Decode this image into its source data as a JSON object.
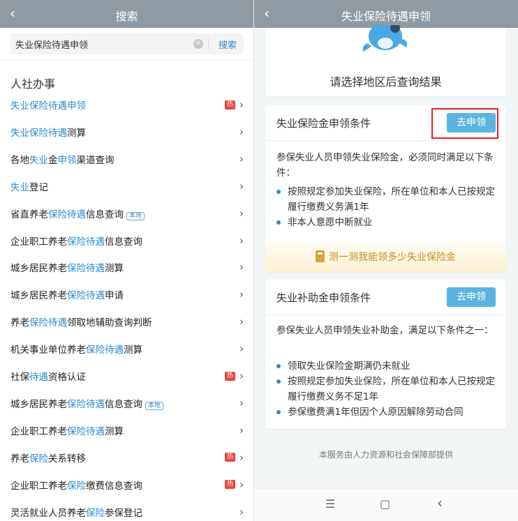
{
  "left": {
    "back_icon": "chevron-left-icon",
    "title": "搜索",
    "search_value": "失业保险待遇申领",
    "search_button": "搜索",
    "section_title": "人社办事",
    "items": [
      {
        "parts": [
          [
            "失业保险待遇申领",
            1
          ]
        ],
        "badge": "热"
      },
      {
        "parts": [
          [
            "失业保险待遇",
            1
          ],
          [
            "测算",
            0
          ]
        ]
      },
      {
        "parts": [
          [
            "各地",
            0
          ],
          [
            "失业",
            1
          ],
          [
            "金",
            0
          ],
          [
            "申领",
            1
          ],
          [
            "渠道查询",
            0
          ]
        ]
      },
      {
        "parts": [
          [
            "失业",
            1
          ],
          [
            "登记",
            0
          ]
        ]
      },
      {
        "parts": [
          [
            "省直养老",
            0
          ],
          [
            "保险待遇",
            1
          ],
          [
            "信息查询",
            0
          ]
        ],
        "tag": "本地"
      },
      {
        "parts": [
          [
            "企业职工养老",
            0
          ],
          [
            "保险待遇",
            1
          ],
          [
            "信息查询",
            0
          ]
        ]
      },
      {
        "parts": [
          [
            "城乡居民养老",
            0
          ],
          [
            "保险待遇",
            1
          ],
          [
            "测算",
            0
          ]
        ]
      },
      {
        "parts": [
          [
            "城乡居民养老",
            0
          ],
          [
            "保险待遇",
            1
          ],
          [
            "申请",
            0
          ]
        ]
      },
      {
        "parts": [
          [
            "养老",
            0
          ],
          [
            "保险待遇",
            1
          ],
          [
            "领取地辅助查询判断",
            0
          ]
        ]
      },
      {
        "parts": [
          [
            "机关事业单位养老",
            0
          ],
          [
            "保险待遇",
            1
          ],
          [
            "测算",
            0
          ]
        ]
      },
      {
        "parts": [
          [
            "社保",
            0
          ],
          [
            "待遇",
            1
          ],
          [
            "资格认证",
            0
          ]
        ],
        "badge": "热"
      },
      {
        "parts": [
          [
            "城乡居民养老",
            0
          ],
          [
            "保险待遇",
            1
          ],
          [
            "信息查询",
            0
          ]
        ],
        "tag": "本地"
      },
      {
        "parts": [
          [
            "企业职工养老",
            0
          ],
          [
            "保险待遇",
            1
          ],
          [
            "测算",
            0
          ]
        ]
      },
      {
        "parts": [
          [
            "养老",
            0
          ],
          [
            "保险",
            1
          ],
          [
            "关系转移",
            0
          ]
        ],
        "badge": "热"
      },
      {
        "parts": [
          [
            "企业职工养老",
            0
          ],
          [
            "保险",
            1
          ],
          [
            "缴费信息查询",
            0
          ]
        ],
        "badge": "热"
      },
      {
        "parts": [
          [
            "灵活就业人员养老",
            0
          ],
          [
            "保险",
            1
          ],
          [
            "参保登记",
            0
          ]
        ]
      }
    ]
  },
  "right": {
    "title": "失业保险待遇申领",
    "region_prompt": "请选择地区后查询结果",
    "card1": {
      "heading": "失业保险金申领条件",
      "apply_label": "去申领",
      "desc": "参保失业人员申领失业保险金，必须同时满足以下条件：",
      "bullets": [
        "按照规定参加失业保险，所在单位和本人已按规定履行缴费义务满1年",
        "非本人意愿中断就业"
      ],
      "calc_label": "测一测我能领多少失业保险金"
    },
    "card2": {
      "heading": "失业补助金申领条件",
      "apply_label": "去申领",
      "desc": "参保失业人员申领失业补助金，满足以下条件之一：",
      "bullets": [
        "领取失业保险金期满仍未就业",
        "按照规定参加失业保险，所在单位和本人已按规定履行缴费义务不足1年",
        "参保缴费满1年但因个人原因解除劳动合同"
      ]
    },
    "footer": "本服务由人力资源和社会保障部提供",
    "nav": {
      "menu_glyph": "☰",
      "home_glyph": "▢",
      "back_glyph": "‹"
    }
  },
  "colors": {
    "accent": "#2a8bd2",
    "topbar": "#909aa2",
    "hot": "#e8473c",
    "button": "#5ab3e0",
    "highlight_box": "#e02020"
  }
}
